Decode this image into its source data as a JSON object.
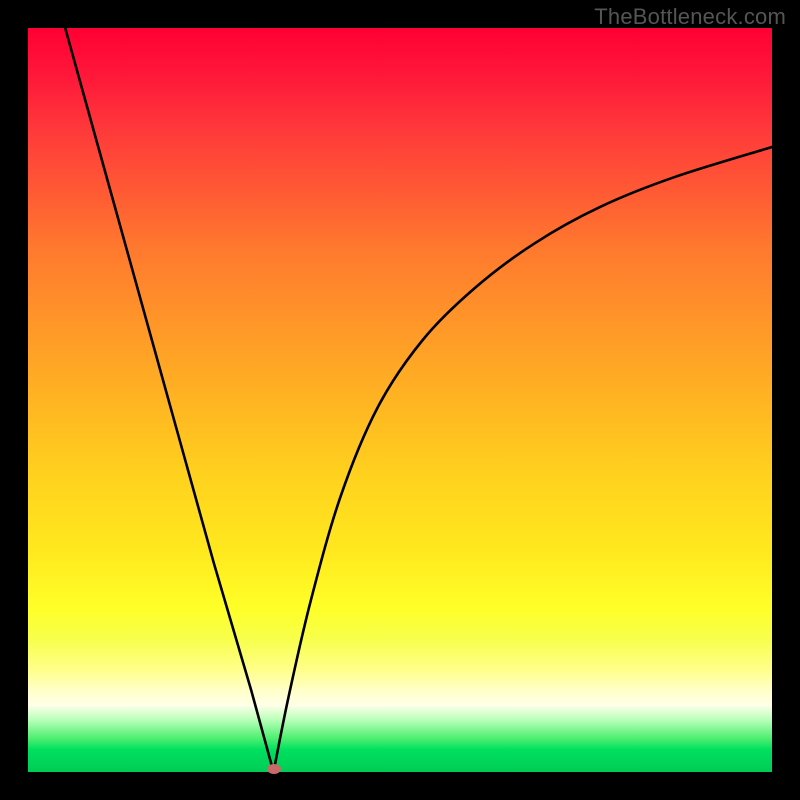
{
  "watermark": "TheBottleneck.com",
  "colors": {
    "frame": "#000000",
    "curve": "#000000",
    "dot": "#c96a6a"
  },
  "chart_data": {
    "type": "line",
    "title": "",
    "xlabel": "",
    "ylabel": "",
    "xlim": [
      0,
      100
    ],
    "ylim": [
      0,
      100
    ],
    "grid": false,
    "legend": false,
    "vertex": {
      "x": 33,
      "y": 0
    },
    "series": [
      {
        "name": "left-branch",
        "x": [
          5,
          10,
          15,
          20,
          25,
          30,
          33
        ],
        "y": [
          100,
          82,
          64,
          46,
          28,
          11,
          0
        ]
      },
      {
        "name": "right-branch",
        "x": [
          33,
          35,
          38,
          42,
          47,
          53,
          60,
          68,
          77,
          87,
          100
        ],
        "y": [
          0,
          10,
          23,
          37,
          49,
          58,
          65,
          71,
          76,
          80,
          84
        ]
      }
    ],
    "annotations": [
      {
        "text": "TheBottleneck.com",
        "position": "top-right"
      }
    ]
  }
}
